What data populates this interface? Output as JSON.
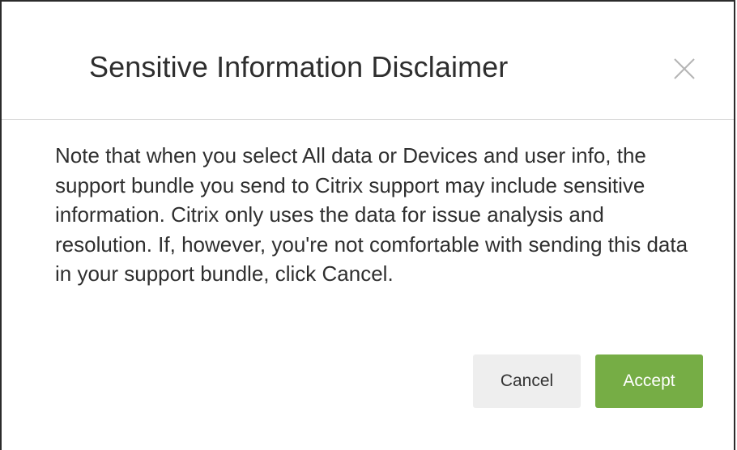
{
  "dialog": {
    "title": "Sensitive Information Disclaimer",
    "close_icon": "close-icon",
    "body": "Note that when you select All data or Devices and user info, the support bundle you send to Citrix support may include sensitive information. Citrix only uses the data for issue analysis and resolution. If, however, you're not comfortable with sending this data in your support bundle, click Cancel.",
    "buttons": {
      "cancel_label": "Cancel",
      "accept_label": "Accept"
    }
  },
  "colors": {
    "accept_button": "#76ad45",
    "cancel_button": "#eeeeee",
    "divider": "#d6d6d6"
  }
}
